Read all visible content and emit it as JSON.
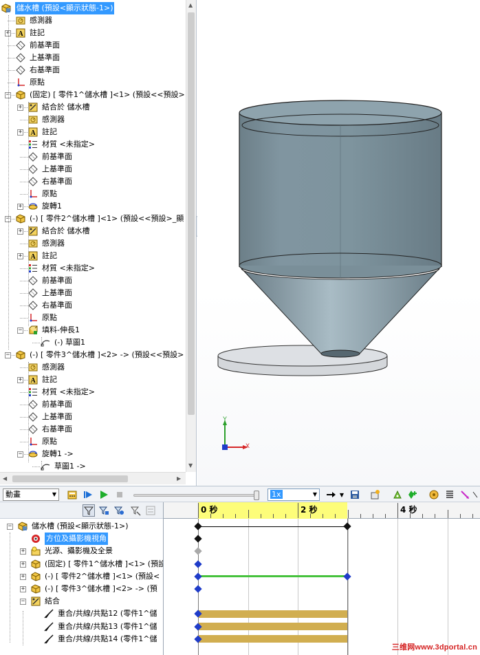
{
  "feature_tree": {
    "root": "儲水槽 (預設<顯示狀態-1>)",
    "items": [
      {
        "label": "儲水槽 (預設<顯示狀態-1>)",
        "icon": "assembly-icon",
        "selected": true
      },
      {
        "label": "感測器",
        "icon": "sensor-icon"
      },
      {
        "label": "註記",
        "icon": "annotation-icon"
      },
      {
        "label": "前基準面",
        "icon": "plane-icon"
      },
      {
        "label": "上基準面",
        "icon": "plane-icon"
      },
      {
        "label": "右基準面",
        "icon": "plane-icon"
      },
      {
        "label": "原點",
        "icon": "origin-icon"
      },
      {
        "label": "(固定) [ 零件1^儲水槽 ]<1> (預設<<預設>",
        "icon": "part-icon"
      },
      {
        "label": "結合於 儲水槽",
        "icon": "mates-icon"
      },
      {
        "label": "感測器",
        "icon": "sensor-icon"
      },
      {
        "label": "註記",
        "icon": "annotation-icon"
      },
      {
        "label": "材質 <未指定>",
        "icon": "material-icon"
      },
      {
        "label": "前基準面",
        "icon": "plane-icon"
      },
      {
        "label": "上基準面",
        "icon": "plane-icon"
      },
      {
        "label": "右基準面",
        "icon": "plane-icon"
      },
      {
        "label": "原點",
        "icon": "origin-icon"
      },
      {
        "label": "旋轉1",
        "icon": "revolve-icon"
      },
      {
        "label": "(-) [ 零件2^儲水槽 ]<1> (預設<<預設>_顯",
        "icon": "part-icon"
      },
      {
        "label": "結合於 儲水槽",
        "icon": "mates-icon"
      },
      {
        "label": "感測器",
        "icon": "sensor-icon"
      },
      {
        "label": "註記",
        "icon": "annotation-icon"
      },
      {
        "label": "材質 <未指定>",
        "icon": "material-icon"
      },
      {
        "label": "前基準面",
        "icon": "plane-icon"
      },
      {
        "label": "上基準面",
        "icon": "plane-icon"
      },
      {
        "label": "右基準面",
        "icon": "plane-icon"
      },
      {
        "label": "原點",
        "icon": "origin-icon"
      },
      {
        "label": "填料-伸長1",
        "icon": "extrude-icon"
      },
      {
        "label": "(-) 草圖1",
        "icon": "sketch-icon"
      },
      {
        "label": "(-) [ 零件3^儲水槽 ]<2> -> (預設<<預設>",
        "icon": "part-icon"
      },
      {
        "label": "感測器",
        "icon": "sensor-icon"
      },
      {
        "label": "註記",
        "icon": "annotation-icon"
      },
      {
        "label": "材質 <未指定>",
        "icon": "material-icon"
      },
      {
        "label": "前基準面",
        "icon": "plane-icon"
      },
      {
        "label": "上基準面",
        "icon": "plane-icon"
      },
      {
        "label": "右基準面",
        "icon": "plane-icon"
      },
      {
        "label": "原點",
        "icon": "origin-icon"
      },
      {
        "label": "旋轉1 ->",
        "icon": "revolve-icon"
      },
      {
        "label": "草圖1 ->",
        "icon": "sketch-icon"
      }
    ]
  },
  "triad": {
    "y_label": "Y",
    "x_label": "X"
  },
  "motion_toolbar": {
    "study_type": "動畫",
    "playback_speed": "1x"
  },
  "motion_tree": {
    "items": [
      {
        "label": "儲水槽 (預設<顯示狀態-1>)",
        "icon": "assembly-icon"
      },
      {
        "label": "方位及攝影機視角",
        "icon": "orientation-icon",
        "selected": true
      },
      {
        "label": "光源、攝影機及全景",
        "icon": "lights-icon"
      },
      {
        "label": "(固定) [ 零件1^儲水槽 ]<1> (預設",
        "icon": "part-icon"
      },
      {
        "label": "(-) [ 零件2^儲水槽 ]<1> (預設<",
        "icon": "part-icon"
      },
      {
        "label": "(-) [ 零件3^儲水槽 ]<2> -> (預",
        "icon": "part-icon"
      },
      {
        "label": "結合",
        "icon": "mates-icon"
      },
      {
        "label": "重合/共線/共點12 (零件1^儲",
        "icon": "coincident-mate-icon"
      },
      {
        "label": "重合/共線/共點13 (零件1^儲",
        "icon": "coincident-mate-icon"
      },
      {
        "label": "重合/共線/共點14 (零件1^儲",
        "icon": "coincident-mate-icon"
      }
    ]
  },
  "timeline": {
    "labels": [
      "0 秒",
      "2 秒",
      "4 秒"
    ]
  },
  "watermark": "三维网www.3dportal.cn"
}
